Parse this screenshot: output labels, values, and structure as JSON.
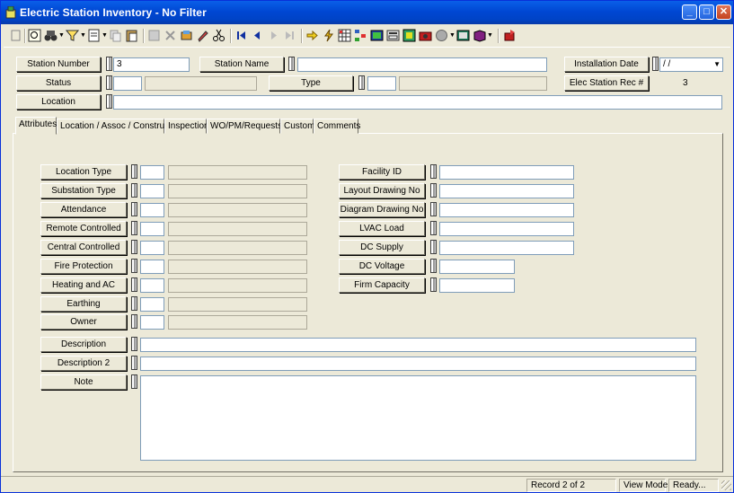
{
  "window": {
    "title": "Electric Station Inventory - No Filter",
    "colors": {
      "titlebar": "#0047d3",
      "face": "#ece9d8"
    }
  },
  "toolbar": {
    "icons": [
      "menu-icon",
      "zoom-icon",
      "binoculars-icon",
      "filter-icon",
      "report-icon",
      "copy-icon",
      "paste-icon",
      "save-icon",
      "delete-icon",
      "edit-icon",
      "pencil-icon",
      "cut-icon",
      "first-record-icon",
      "prev-record-icon",
      "next-record-icon",
      "last-record-icon",
      "goto-icon",
      "lightning-icon",
      "grid-icon",
      "tree-icon",
      "image-icon",
      "form-icon",
      "map-icon",
      "camera-icon",
      "globe-icon",
      "book-icon",
      "help-icon"
    ]
  },
  "header": {
    "station_number_label": "Station Number",
    "station_number_value": "3",
    "station_name_label": "Station Name",
    "station_name_value": "",
    "installation_date_label": "Installation Date",
    "installation_date_value": "/ /",
    "status_label": "Status",
    "type_label": "Type",
    "elec_station_rec_label": "Elec Station Rec #",
    "elec_station_rec_value": "3",
    "location_label": "Location"
  },
  "tabs": [
    "Attributes",
    "Location / Assoc / Construct",
    "Inspection",
    "WO/PM/Requests",
    "Custom",
    "Comments"
  ],
  "attributes": {
    "left_fields": [
      "Location Type",
      "Substation Type",
      "Attendance",
      "Remote Controlled",
      "Central Controlled",
      "Fire Protection",
      "Heating and AC",
      "Earthing",
      "Owner"
    ],
    "right_fields": [
      "Facility ID",
      "Layout Drawing No",
      "Diagram Drawing No",
      "LVAC Load",
      "DC Supply",
      "DC Voltage",
      "Firm Capacity"
    ],
    "description_label": "Description",
    "description2_label": "Description 2",
    "note_label": "Note"
  },
  "statusbar": {
    "record": "Record 2 of 2",
    "mode": "View Mode",
    "state": "Ready..."
  }
}
